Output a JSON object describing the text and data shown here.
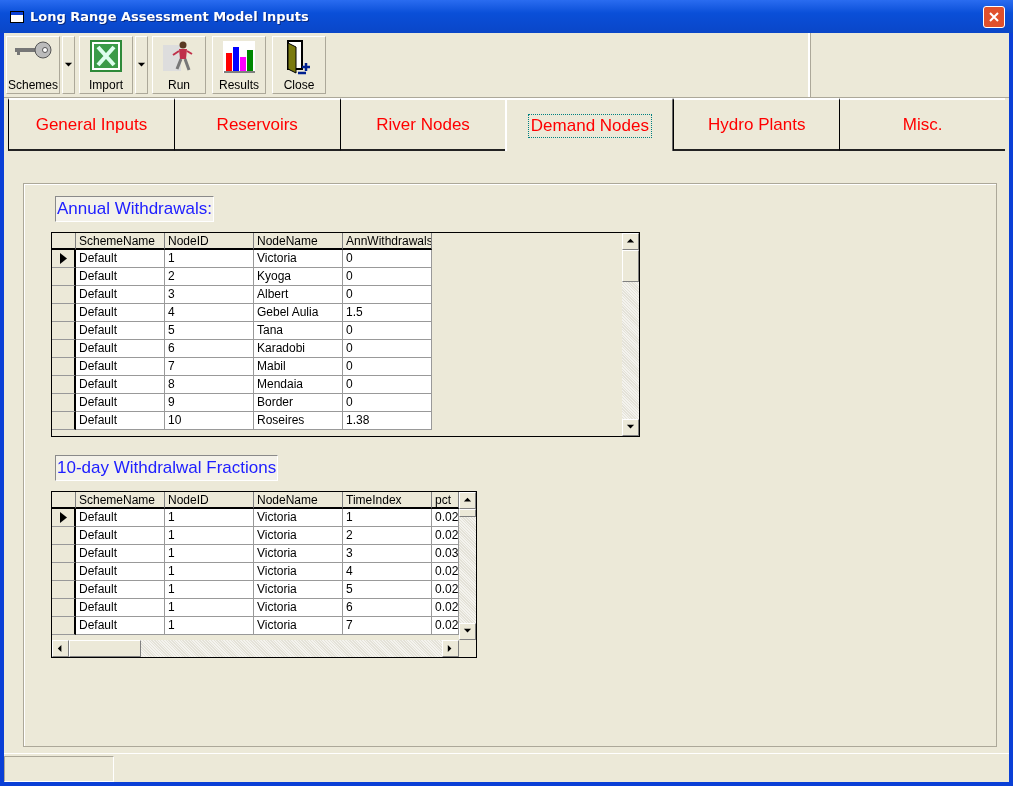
{
  "window": {
    "title": "Long Range Assessment Model Inputs"
  },
  "toolbar": [
    {
      "label": "Schemes",
      "kind": "key",
      "dropdown": true
    },
    {
      "label": "Import",
      "kind": "spreadsheet",
      "dropdown": true
    },
    {
      "label": "Run",
      "kind": "runner",
      "dropdown": false
    },
    {
      "label": "Results",
      "kind": "chart",
      "dropdown": false
    },
    {
      "label": "Close",
      "kind": "door",
      "dropdown": false
    }
  ],
  "tabs": [
    {
      "label": "General Inputs",
      "selected": false
    },
    {
      "label": "Reservoirs",
      "selected": false
    },
    {
      "label": "River Nodes",
      "selected": false
    },
    {
      "label": "Demand Nodes",
      "selected": true
    },
    {
      "label": "Hydro Plants",
      "selected": false
    },
    {
      "label": "Misc.",
      "selected": false
    }
  ],
  "sections": [
    {
      "title": "Annual Withdrawals:",
      "grid": {
        "columns": [
          "SchemeName",
          "NodeID",
          "NodeName",
          "AnnWithdrawals"
        ],
        "horizontal_scroll": false,
        "rows": [
          {
            "selected": true,
            "cells": [
              "Default",
              "1",
              "Victoria",
              "0"
            ]
          },
          {
            "selected": false,
            "cells": [
              "Default",
              "2",
              "Kyoga",
              "0"
            ]
          },
          {
            "selected": false,
            "cells": [
              "Default",
              "3",
              "Albert",
              "0"
            ]
          },
          {
            "selected": false,
            "cells": [
              "Default",
              "4",
              "Gebel  Aulia",
              "1.5"
            ]
          },
          {
            "selected": false,
            "cells": [
              "Default",
              "5",
              "Tana",
              "0"
            ]
          },
          {
            "selected": false,
            "cells": [
              "Default",
              "6",
              "Karadobi",
              "0"
            ]
          },
          {
            "selected": false,
            "cells": [
              "Default",
              "7",
              "Mabil",
              "0"
            ]
          },
          {
            "selected": false,
            "cells": [
              "Default",
              "8",
              "Mendaia",
              "0"
            ]
          },
          {
            "selected": false,
            "cells": [
              "Default",
              "9",
              "Border",
              "0"
            ]
          },
          {
            "selected": false,
            "cells": [
              "Default",
              "10",
              "Roseires",
              "1.38"
            ]
          }
        ]
      }
    },
    {
      "title": "10-day Withdralwal Fractions",
      "grid": {
        "columns": [
          "SchemeName",
          "NodeID",
          "NodeName",
          "TimeIndex",
          "pct"
        ],
        "horizontal_scroll": true,
        "rows": [
          {
            "selected": true,
            "cells": [
              "Default",
              "1",
              "Victoria",
              "1",
              "0.02"
            ]
          },
          {
            "selected": false,
            "cells": [
              "Default",
              "1",
              "Victoria",
              "2",
              "0.02"
            ]
          },
          {
            "selected": false,
            "cells": [
              "Default",
              "1",
              "Victoria",
              "3",
              "0.03"
            ]
          },
          {
            "selected": false,
            "cells": [
              "Default",
              "1",
              "Victoria",
              "4",
              "0.02"
            ]
          },
          {
            "selected": false,
            "cells": [
              "Default",
              "1",
              "Victoria",
              "5",
              "0.02"
            ]
          },
          {
            "selected": false,
            "cells": [
              "Default",
              "1",
              "Victoria",
              "6",
              "0.02"
            ]
          },
          {
            "selected": false,
            "cells": [
              "Default",
              "1",
              "Victoria",
              "7",
              "0.02"
            ]
          }
        ]
      }
    }
  ]
}
